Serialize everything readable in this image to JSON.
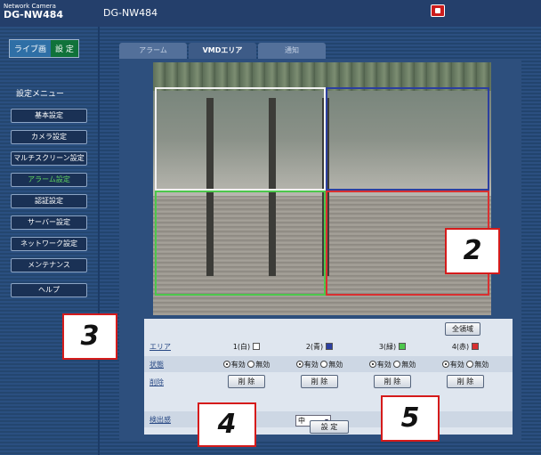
{
  "header": {
    "brand_line1": "Network Camera",
    "brand_line2": "DG-NW484",
    "model": "DG-NW484"
  },
  "sidebar": {
    "top_tabs": [
      "ライブ画",
      "設 定"
    ],
    "menu_title": "設定メニュー",
    "items": [
      {
        "label": "基本設定"
      },
      {
        "label": "カメラ設定"
      },
      {
        "label": "マルチスクリーン設定"
      },
      {
        "label": "アラーム設定"
      },
      {
        "label": "認証設定"
      },
      {
        "label": "サーバー設定"
      },
      {
        "label": "ネットワーク設定"
      },
      {
        "label": "メンテナンス"
      },
      {
        "label": "ヘルプ"
      }
    ]
  },
  "tabs": [
    "アラーム",
    "VMDエリア",
    "通知"
  ],
  "panel": {
    "all_area_button": "全領域",
    "row_area": "エリア",
    "row_status": "状態",
    "row_delete": "削除",
    "row_sensitivity": "検出感",
    "areas": [
      {
        "label": "1(白)",
        "color": "#ffffff"
      },
      {
        "label": "2(青)",
        "color": "#2c3fa0"
      },
      {
        "label": "3(緑)",
        "color": "#4cc74c"
      },
      {
        "label": "4(赤)",
        "color": "#d93030"
      }
    ],
    "enable_label": "有効",
    "disable_label": "無効",
    "delete_button": "削 除",
    "sensitivity_value": "中",
    "set_button": "設 定"
  },
  "callouts": [
    "2",
    "3",
    "4",
    "5"
  ]
}
